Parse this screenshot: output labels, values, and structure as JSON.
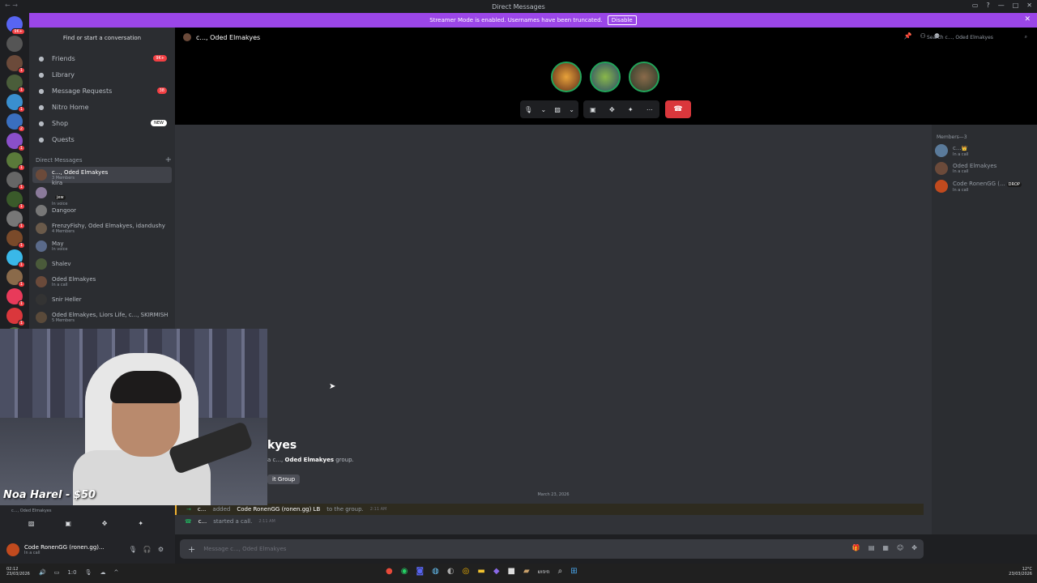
{
  "window": {
    "title": "Direct Messages"
  },
  "banner": {
    "text": "Streamer Mode is enabled. Usernames have been truncated.",
    "disable": "Disable"
  },
  "servers": [
    {
      "badge": "9K+",
      "color": "#5865f2"
    },
    {
      "badge": "",
      "color": "#555"
    },
    {
      "badge": "1",
      "color": "#6b4a3a"
    },
    {
      "badge": "1",
      "color": "#4a5d3a"
    },
    {
      "badge": "1",
      "color": "#3a8fcf"
    },
    {
      "badge": "2",
      "color": "#3a6fbf"
    },
    {
      "badge": "1",
      "color": "#8a4fc9"
    },
    {
      "badge": "1",
      "color": "#5a7a3a"
    },
    {
      "badge": "1",
      "color": "#666"
    },
    {
      "badge": "1",
      "color": "#3a5a2a"
    },
    {
      "badge": "1",
      "color": "#777"
    },
    {
      "badge": "1",
      "color": "#7a4a2a"
    },
    {
      "badge": "1",
      "color": "#3ab8e8"
    },
    {
      "badge": "1",
      "color": "#8a6a4a"
    },
    {
      "badge": "1",
      "color": "#e83a5a"
    },
    {
      "badge": "1",
      "color": "#da373c"
    },
    {
      "badge": "1",
      "color": "#4a6a3a"
    }
  ],
  "sidebar": {
    "find": "Find or start a conversation",
    "nav": [
      {
        "label": "Friends",
        "icon": "friends-icon",
        "badge": "9K+"
      },
      {
        "label": "Library",
        "icon": "library-icon"
      },
      {
        "label": "Message Requests",
        "icon": "mail-icon",
        "badge": "38"
      },
      {
        "label": "Nitro Home",
        "icon": "nitro-icon"
      },
      {
        "label": "Shop",
        "icon": "shop-icon",
        "new": "NEW"
      },
      {
        "label": "Quests",
        "icon": "quests-icon"
      }
    ],
    "dm_header": "Direct Messages",
    "dms": [
      {
        "name": "c..., Oded Elmakyes",
        "sub": "3 Members",
        "selected": true
      },
      {
        "name": "kira",
        "tag": "jew",
        "sub": "In voice"
      },
      {
        "name": "Dangoor",
        "sub": ""
      },
      {
        "name": "FrenzyFishy, Oded Elmakyes, idandushy",
        "sub": "4 Members"
      },
      {
        "name": "May",
        "sub": "In voice"
      },
      {
        "name": "Shalev",
        "sub": ""
      },
      {
        "name": "Oded Elmakyes",
        "sub": "In a call"
      },
      {
        "name": "Snir Heller",
        "sub": ""
      },
      {
        "name": "Oded Elmakyes, Liors Life, c..., SKIRMISH",
        "sub": "5 Members"
      }
    ]
  },
  "header": {
    "title": "c..., Oded Elmakyes",
    "search": "Search c..., Oded Elmakyes"
  },
  "members": {
    "title": "Members—3",
    "list": [
      {
        "name": "c...",
        "sub": "In a call",
        "crown": "👑"
      },
      {
        "name": "Oded Elmakyes",
        "sub": "In a call"
      },
      {
        "name": "Code RonenGG (...",
        "sub": "In a call",
        "tag": "DROP"
      }
    ]
  },
  "chat": {
    "welcome_title": "kyes",
    "welcome_sub_pre": "a c..., ",
    "welcome_sub_bold": "Oded Elmakyes",
    "welcome_sub_post": " group.",
    "edit_group": "it Group",
    "date": "March 23, 2026",
    "msg1": {
      "user": "c...",
      "verb": "added",
      "target": "Code RonenGG (ronen.gg) LB",
      "rest": "to the group.",
      "time": "2:11 AM"
    },
    "msg2": {
      "user": "c...",
      "verb": "started a call.",
      "time": "2:11 AM"
    },
    "composer_placeholder": "Message c..., Oded Elmakyes"
  },
  "overlay": {
    "donation": "Noa Harel - $50"
  },
  "voice": {
    "status": "c..., Oded Elmakyes",
    "user": "Code RonenGG (ronen.gg)...",
    "user_sub": "In a call"
  },
  "taskbar": {
    "time": "02:12",
    "date": "23/03/2026",
    "weather": "12°C",
    "right_date": "23/03/2026",
    "search": "חיפוש",
    "zoom": "1:0"
  }
}
